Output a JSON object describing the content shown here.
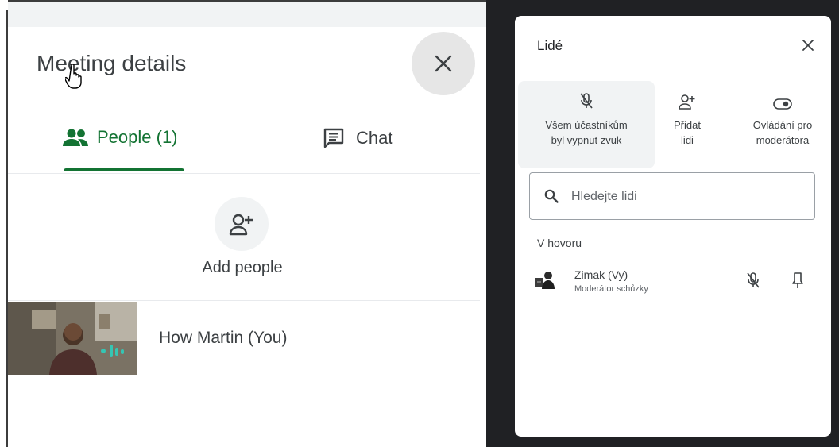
{
  "left": {
    "title": "Meeting details",
    "tabs": [
      {
        "label": "People (1)",
        "icon": "people-icon",
        "active": true
      },
      {
        "label": "Chat",
        "icon": "chat-icon",
        "active": false
      }
    ],
    "add_people_label": "Add people",
    "participant_name": "How Martin (You)"
  },
  "right": {
    "title": "Lidé",
    "controls": [
      {
        "label_line1": "Všem účastníkům",
        "label_line2": "byl vypnut zvuk",
        "icon": "mic-off-icon"
      },
      {
        "label_line1": "Přidat",
        "label_line2": "lidi",
        "icon": "add-person-icon"
      },
      {
        "label_line1": "Ovládání pro",
        "label_line2": "moderátora",
        "icon": "toggle-icon"
      }
    ],
    "search_placeholder": "Hledejte lidi",
    "section_label": "V hovoru",
    "person": {
      "name": "Zimak (Vy)",
      "role": "Moderátor schůzky"
    }
  },
  "colors": {
    "accent_green": "#137333",
    "panel_bg": "#ffffff",
    "dark_bg": "#202124"
  }
}
